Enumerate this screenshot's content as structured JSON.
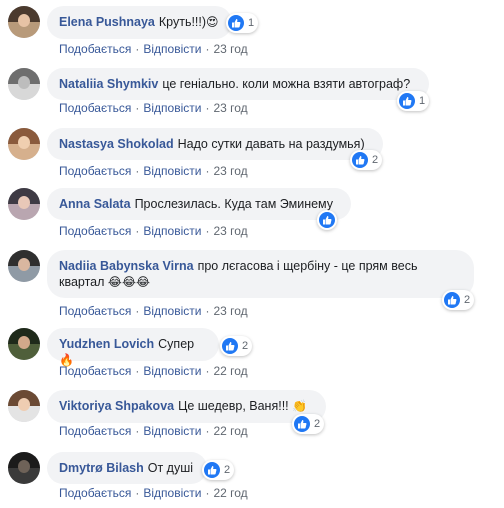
{
  "labels": {
    "like": "Подобається",
    "reply": "Відповісти",
    "separator": "·"
  },
  "comments": [
    {
      "author": "Elena Pushnaya",
      "text": "Круть!!!)",
      "emoji": "😍",
      "reactions": "1",
      "time": "23 год"
    },
    {
      "author": "Nataliia Shymkiv",
      "text": "це геніально. коли можна взяти автограф?",
      "emoji": "",
      "reactions": "1",
      "time": "23 год"
    },
    {
      "author": "Nastasya Shokolad",
      "text": "Надо сутки давать на раздумья)",
      "emoji": "",
      "reactions": "2",
      "time": "23 год"
    },
    {
      "author": "Anna Salata",
      "text": "Прослезилась. Куда там Эминему",
      "emoji": "",
      "reactions": "",
      "time": "23 год"
    },
    {
      "author": "Nadiia Babynska Virna",
      "text_line1": "про лєгасова і щербіну - це прям весь",
      "text_line2": "квартал",
      "emoji": "😂😂😂",
      "reactions": "2",
      "time": "23 год"
    },
    {
      "author": "Yudzhen Lovich",
      "text": "Супер",
      "emoji": "🔥",
      "reactions": "2",
      "time": "22 год"
    },
    {
      "author": "Viktoriya Shpakova",
      "text": "Це шедевр, Ваня!!!",
      "emoji": "👏",
      "reactions": "2",
      "time": "22 год"
    },
    {
      "author": "Dmytrø Bilash",
      "text": "От душі",
      "emoji": "",
      "reactions": "2",
      "time": "22 год"
    }
  ],
  "colors": {
    "author": "#385898",
    "bubble": "#f2f3f5",
    "like_blue": "#2078f4",
    "meta_gray": "#606770"
  },
  "icons": {
    "like": "like-icon"
  }
}
